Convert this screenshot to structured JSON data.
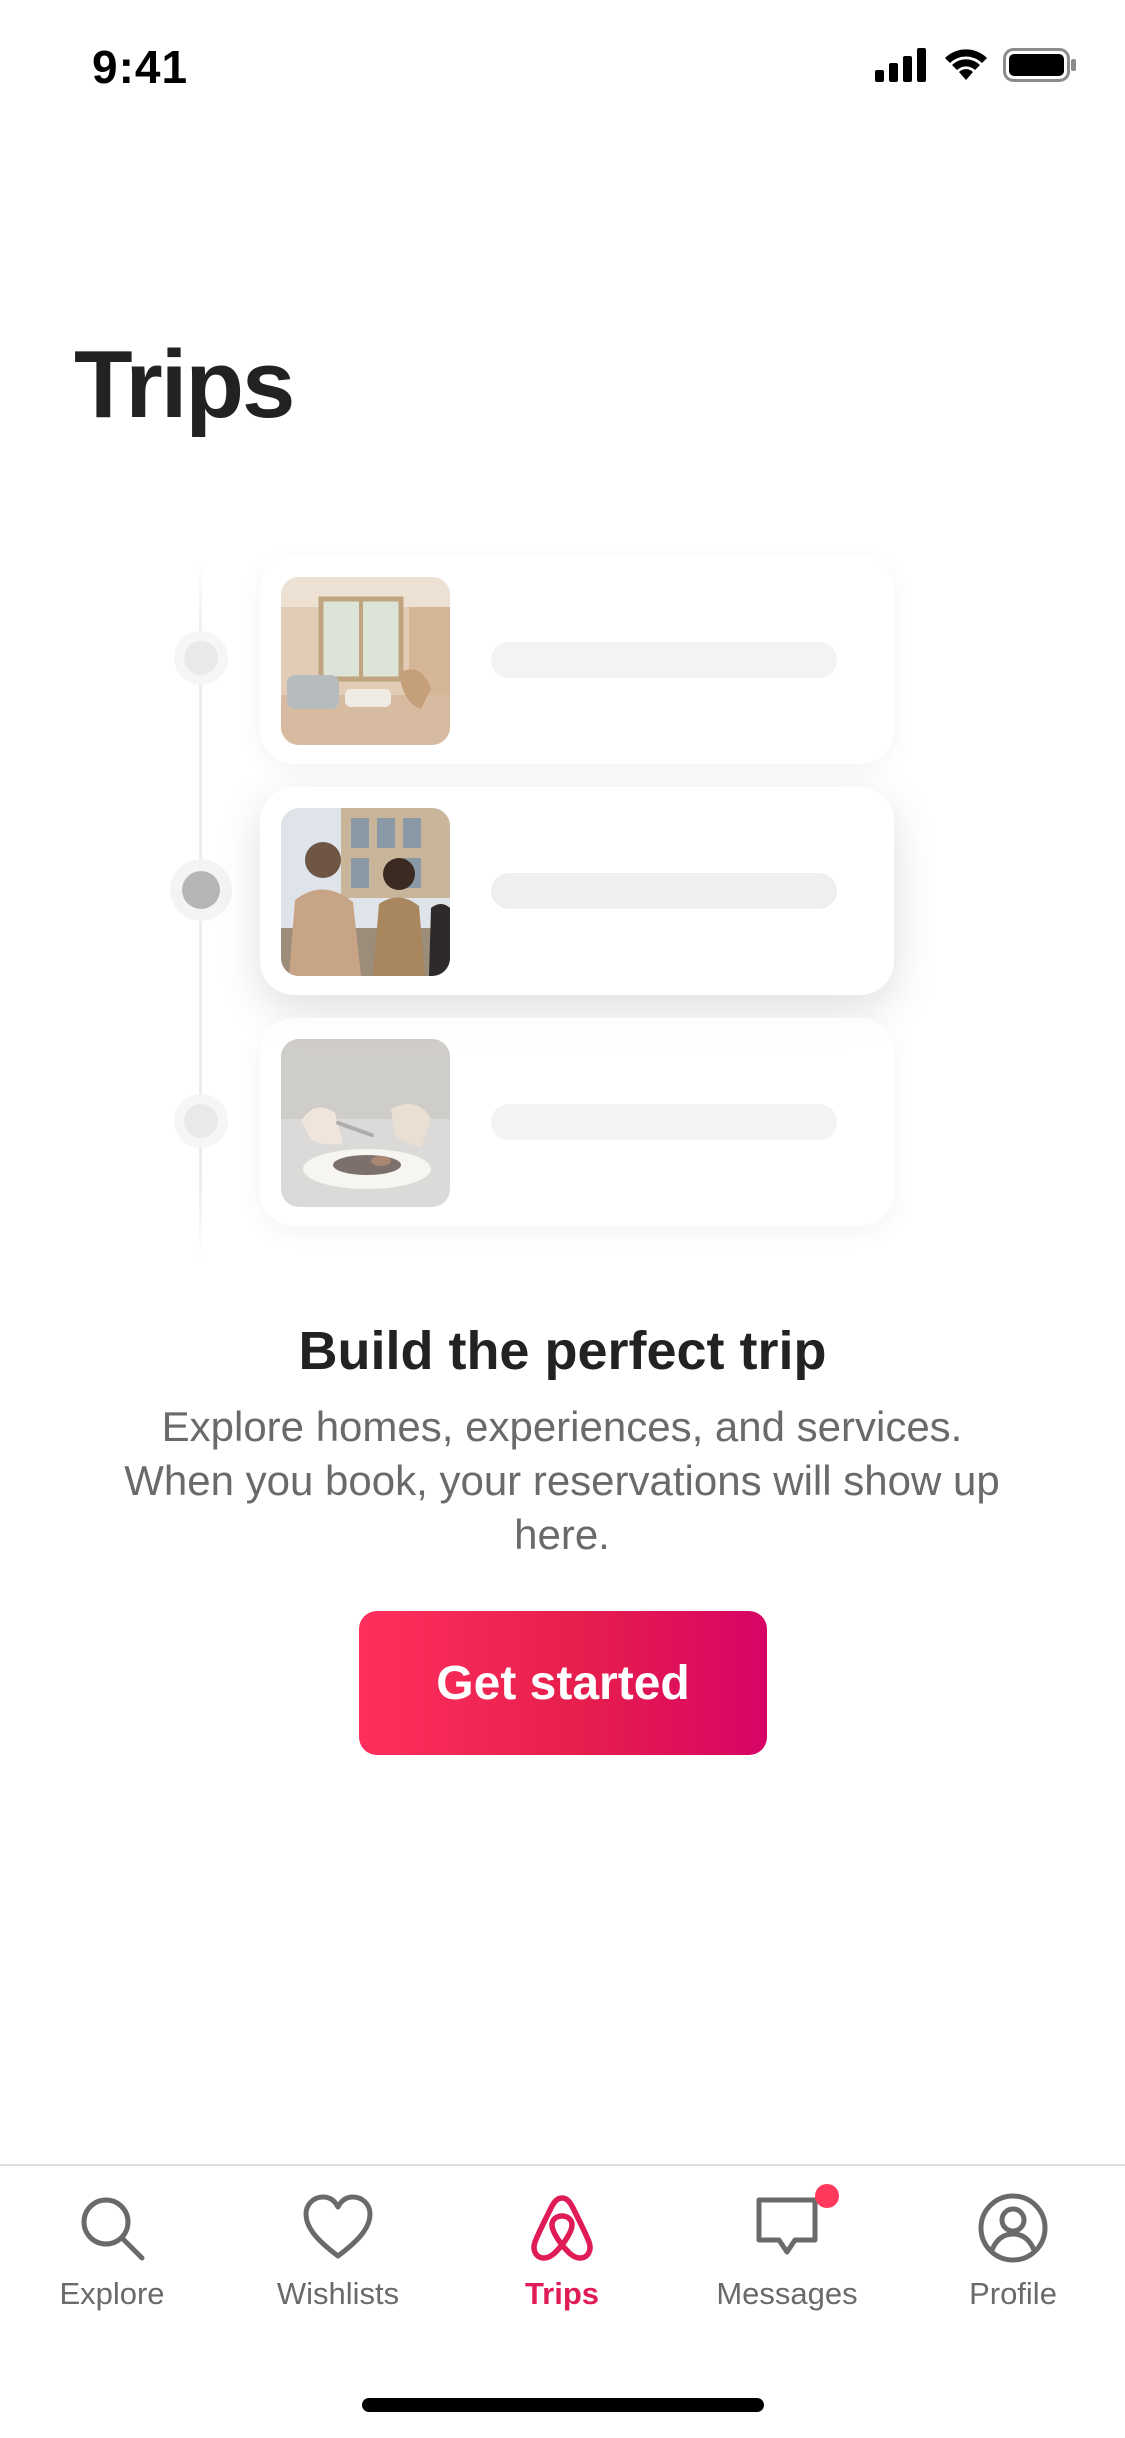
{
  "status_bar": {
    "time": "9:41"
  },
  "page": {
    "title": "Trips"
  },
  "illustration": {
    "cards": [
      {
        "thumbnail": "home-interior-photo",
        "state": "faded"
      },
      {
        "thumbnail": "people-sightseeing-photo",
        "state": "active"
      },
      {
        "thumbnail": "food-plating-photo",
        "state": "faded"
      }
    ]
  },
  "empty_state": {
    "headline": "Build the perfect trip",
    "body": "Explore homes, experiences, and services. When you book, your reservations will show up here.",
    "cta_label": "Get started"
  },
  "tab_bar": {
    "tabs": [
      {
        "label": "Explore",
        "icon": "search-icon"
      },
      {
        "label": "Wishlists",
        "icon": "heart-icon"
      },
      {
        "label": "Trips",
        "icon": "airbnb-logo-icon",
        "active": true
      },
      {
        "label": "Messages",
        "icon": "message-icon",
        "has_notification": true
      },
      {
        "label": "Profile",
        "icon": "profile-icon"
      }
    ]
  },
  "colors": {
    "brand": "#FF385C",
    "brand_dark": "#E01C57",
    "text_primary": "#222222",
    "text_secondary": "#6A6A6A"
  }
}
